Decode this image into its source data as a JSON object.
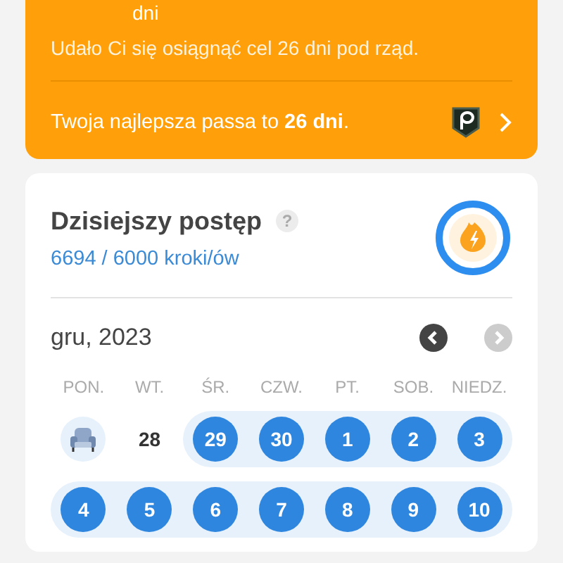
{
  "streak_card": {
    "unit": "dni",
    "message": "Udało Ci się osiągnąć cel 26 dni pod rząd.",
    "best": "Twoja najlepsza passa to **26 dni**."
  },
  "progress_card": {
    "title": "Dzisiejszy postęp",
    "help": "?",
    "steps": "6694 / 6000 kroki/ów"
  },
  "calendar": {
    "month": "gru, 2023",
    "prev_disabled": false,
    "next_disabled": true,
    "weekdays": [
      "PON.",
      "WT.",
      "ŚR.",
      "CZW.",
      "PT.",
      "SOB.",
      "NIEDZ."
    ],
    "weeks": [
      [
        {
          "kind": "rest"
        },
        {
          "kind": "day",
          "label": "28",
          "done": false
        },
        {
          "kind": "day",
          "label": "29",
          "done": true
        },
        {
          "kind": "day",
          "label": "30",
          "done": true
        },
        {
          "kind": "day",
          "label": "1",
          "done": true
        },
        {
          "kind": "day",
          "label": "2",
          "done": true
        },
        {
          "kind": "day",
          "label": "3",
          "done": true
        }
      ],
      [
        {
          "kind": "day",
          "label": "4",
          "done": true
        },
        {
          "kind": "day",
          "label": "5",
          "done": true
        },
        {
          "kind": "day",
          "label": "6",
          "done": true
        },
        {
          "kind": "day",
          "label": "7",
          "done": true
        },
        {
          "kind": "day",
          "label": "8",
          "done": true
        },
        {
          "kind": "day",
          "label": "9",
          "done": true
        },
        {
          "kind": "day",
          "label": "10",
          "done": true
        }
      ]
    ]
  }
}
